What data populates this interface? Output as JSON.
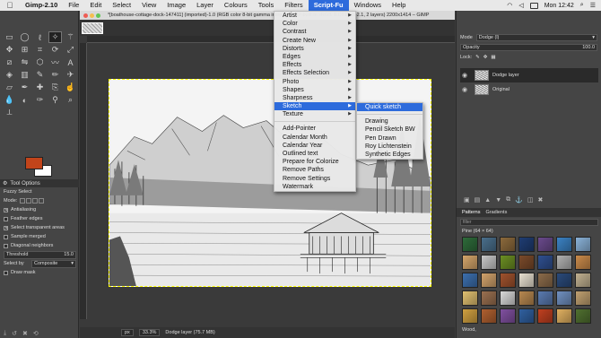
{
  "menubar": {
    "apple": "",
    "app": "Gimp-2.10",
    "items": [
      "File",
      "Edit",
      "Select",
      "View",
      "Image",
      "Layer",
      "Colours",
      "Tools",
      "Filters",
      "Script-Fu",
      "Windows",
      "Help"
    ],
    "active": "Script-Fu",
    "clock": "Mon 12:42"
  },
  "window": {
    "title": "*[boathouse-cottage-dock-147411] (imported)-1.0 (RGB color 8-bit gamma integer, GIMP built-in sRGB IEC61966-2.1, 2 layers) 2200x1414 – GIMP"
  },
  "script_menu": {
    "items": [
      {
        "label": "Artist",
        "sub": true
      },
      {
        "label": "Color",
        "sub": true
      },
      {
        "label": "Contrast",
        "sub": true
      },
      {
        "label": "Create New",
        "sub": true
      },
      {
        "label": "Distorts",
        "sub": true
      },
      {
        "label": "Edges",
        "sub": true
      },
      {
        "label": "Effects",
        "sub": true
      },
      {
        "label": "Effects Selection",
        "sub": true
      },
      {
        "label": "Photo",
        "sub": true
      },
      {
        "label": "Shapes",
        "sub": true
      },
      {
        "label": "Sharpness",
        "sub": true
      },
      {
        "label": "Sketch",
        "sub": true
      },
      {
        "label": "Texture",
        "sub": true
      }
    ],
    "actions": [
      "Add-Pointer",
      "Calendar Month",
      "Calendar Year",
      "Outlined text",
      "Prepare for Colorize",
      "Remove Paths",
      "Remove Settings",
      "Watermark"
    ],
    "highlighted": "Sketch"
  },
  "sketch_menu": {
    "items": [
      "Quick sketch",
      "Drawing",
      "Pencil Sketch BW",
      "Pen Drawn",
      "Roy Lichtenstein",
      "Synthetic Edges"
    ],
    "highlighted": "Quick sketch"
  },
  "toolbox": {
    "tools": [
      "rect-select",
      "ellipse-select",
      "free-select",
      "fuzzy-select",
      "wand",
      "move",
      "align",
      "crop",
      "rotate",
      "scale",
      "shear",
      "flip",
      "cage",
      "warp",
      "text",
      "bucket",
      "gradient",
      "paintbrush",
      "pencil",
      "airbrush",
      "eraser",
      "ink",
      "heal",
      "clone",
      "smudge",
      "blur",
      "dodge",
      "path",
      "color-picker",
      "zoom",
      "measure"
    ],
    "fg_color": "#c2441a",
    "bg_color": "#ffffff"
  },
  "tool_options": {
    "tabs": [
      "Tool Options"
    ],
    "tool_name": "Fuzzy Select",
    "mode_label": "Mode:",
    "antialiasing": "Antialiasing",
    "feather": "Feather edges",
    "transparent": "Select transparent areas",
    "sample_merged": "Sample merged",
    "diagonal": "Diagonal neighbors",
    "threshold_label": "Threshold",
    "threshold_value": "15.0",
    "select_by_label": "Select by",
    "select_by_value": "Composite",
    "draw_mask": "Draw mask"
  },
  "statusbar": {
    "unit": "px",
    "zoom": "33.3%",
    "layer_info": "Dodge layer (75.7 MB)"
  },
  "dock": {
    "mode_label": "Mode",
    "mode_value": "Dodge (l)",
    "opacity_label": "Opacity",
    "opacity_value": "100.0",
    "lock_label": "Lock:",
    "layers": [
      {
        "name": "Dodge layer",
        "selected": true
      },
      {
        "name": "Original",
        "selected": false
      }
    ],
    "tabs": [
      "Patterns",
      "Gradients"
    ],
    "filter_placeholder": "filter",
    "pattern_name": "Pine (64 × 64)",
    "pattern_footer": "Wood,"
  },
  "patterns": [
    "#2e6b3a",
    "#4a6f8c",
    "#8c6a3c",
    "#1f3d73",
    "#6a4a8c",
    "#3b82c4",
    "#8ab2d8",
    "#d4a56a",
    "#c8c8c8",
    "#6b8e23",
    "#7a4a2a",
    "#2f4f8f",
    "#b0b0b0",
    "#c98a4a",
    "#3c6fae",
    "#d1a26b",
    "#a0522d",
    "#e8e0d0",
    "#8b6b4a",
    "#2a4a7a",
    "#c0b090",
    "#e0c070",
    "#9a7050",
    "#d8d8d8",
    "#b88850",
    "#5a7ab0",
    "#7090c0",
    "#c0a070",
    "#d0a040",
    "#b06030",
    "#8050a0",
    "#3060a0",
    "#c04020",
    "#e0b060",
    "#507030"
  ]
}
